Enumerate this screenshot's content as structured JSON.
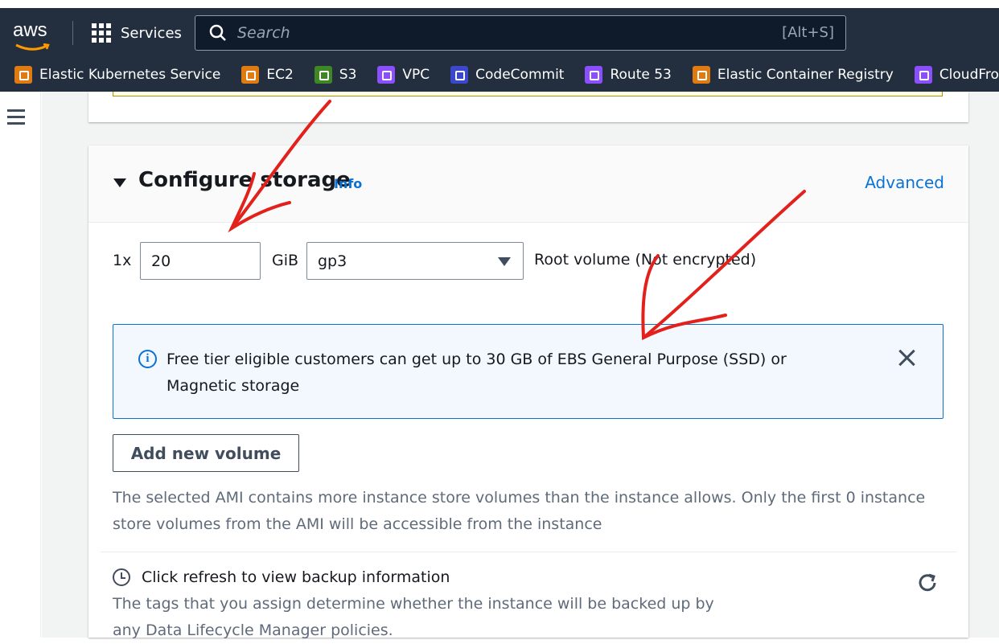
{
  "topnav": {
    "logo": "aws",
    "services_label": "Services",
    "search_placeholder": "Search",
    "search_shortcut": "[Alt+S]"
  },
  "favorites": [
    {
      "label": "Elastic Kubernetes Service",
      "color": "#e07b12"
    },
    {
      "label": "EC2",
      "color": "#e07b12"
    },
    {
      "label": "S3",
      "color": "#3f8624"
    },
    {
      "label": "VPC",
      "color": "#8c4fff"
    },
    {
      "label": "CodeCommit",
      "color": "#3b48cc"
    },
    {
      "label": "Route 53",
      "color": "#8c4fff"
    },
    {
      "label": "Elastic Container Registry",
      "color": "#e07b12"
    },
    {
      "label": "CloudFront",
      "color": "#8c4fff"
    }
  ],
  "storage": {
    "title": "Configure storage",
    "info": "Info",
    "advanced": "Advanced",
    "quantity": "1x",
    "size_value": "20",
    "unit": "GiB",
    "volume_type": "gp3",
    "root_volume_text": "Root volume  (Not encrypted)",
    "alert_text": "Free tier eligible customers can get up to 30 GB of EBS General Purpose (SSD) or Magnetic storage",
    "add_volume": "Add new volume",
    "ami_message": "The selected AMI contains more instance store volumes than the instance allows. Only the first 0 instance store volumes from the AMI will be accessible from the instance",
    "backup_title": "Click refresh to view backup information",
    "tags_message": "The tags that you assign determine whether the instance will be backed up by any Data Lifecycle Manager policies."
  },
  "colors": {
    "nav_bg": "#232f3e",
    "link_blue": "#0972d3",
    "annotation_red": "#e3211c"
  }
}
